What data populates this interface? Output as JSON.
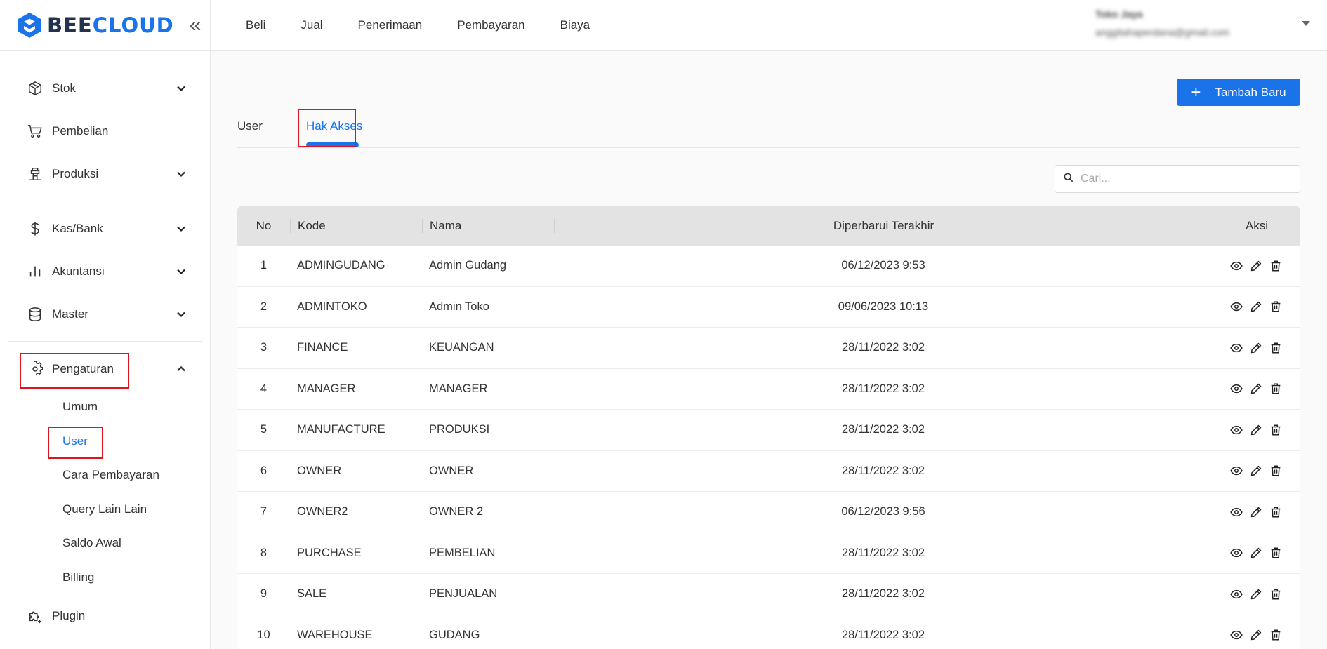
{
  "brand": {
    "part1": "BEE",
    "part2": "CLOUD",
    "collapse_glyph": "«",
    "accent": "#1a73e8",
    "dark": "#23324f"
  },
  "sidebar": {
    "items": [
      {
        "label": "Stok",
        "icon": "box-icon",
        "expandable": true
      },
      {
        "label": "Pembelian",
        "icon": "cart-icon",
        "expandable": false
      },
      {
        "label": "Produksi",
        "icon": "factory-icon",
        "expandable": true
      },
      {
        "label": "Kas/Bank",
        "icon": "dollar-icon",
        "expandable": true
      },
      {
        "label": "Akuntansi",
        "icon": "bar-chart-icon",
        "expandable": true
      },
      {
        "label": "Master",
        "icon": "database-icon",
        "expandable": true
      },
      {
        "label": "Pengaturan",
        "icon": "gear-icon",
        "expandable": true,
        "expanded": true
      },
      {
        "label": "Plugin",
        "icon": "puzzle-icon",
        "expandable": false
      }
    ],
    "subitems": [
      "Umum",
      "User",
      "Cara Pembayaran",
      "Query Lain Lain",
      "Saldo Awal",
      "Billing"
    ],
    "active_subitem": "User"
  },
  "topbar": {
    "menu": [
      "Beli",
      "Jual",
      "Penerimaan",
      "Pembayaran",
      "Biaya"
    ],
    "user_name": "Toko Jaya",
    "user_email": "anggitahaperdana@gmail.com"
  },
  "main": {
    "add_button": "Tambah Baru",
    "tabs": [
      "User",
      "Hak Akses"
    ],
    "active_tab": "Hak Akses",
    "search_placeholder": "Cari...",
    "columns": [
      "No",
      "Kode",
      "Nama",
      "Diperbarui Terakhir",
      "Aksi"
    ],
    "rows": [
      [
        "1",
        "ADMINGUDANG",
        "Admin Gudang",
        "06/12/2023 9:53"
      ],
      [
        "2",
        "ADMINTOKO",
        "Admin Toko",
        "09/06/2023 10:13"
      ],
      [
        "3",
        "FINANCE",
        "KEUANGAN",
        "28/11/2022 3:02"
      ],
      [
        "4",
        "MANAGER",
        "MANAGER",
        "28/11/2022 3:02"
      ],
      [
        "5",
        "MANUFACTURE",
        "PRODUKSI",
        "28/11/2022 3:02"
      ],
      [
        "6",
        "OWNER",
        "OWNER",
        "28/11/2022 3:02"
      ],
      [
        "7",
        "OWNER2",
        "OWNER 2",
        "06/12/2023 9:56"
      ],
      [
        "8",
        "PURCHASE",
        "PEMBELIAN",
        "28/11/2022 3:02"
      ],
      [
        "9",
        "SALE",
        "PENJUALAN",
        "28/11/2022 3:02"
      ],
      [
        "10",
        "WAREHOUSE",
        "GUDANG",
        "28/11/2022 3:02"
      ]
    ]
  }
}
